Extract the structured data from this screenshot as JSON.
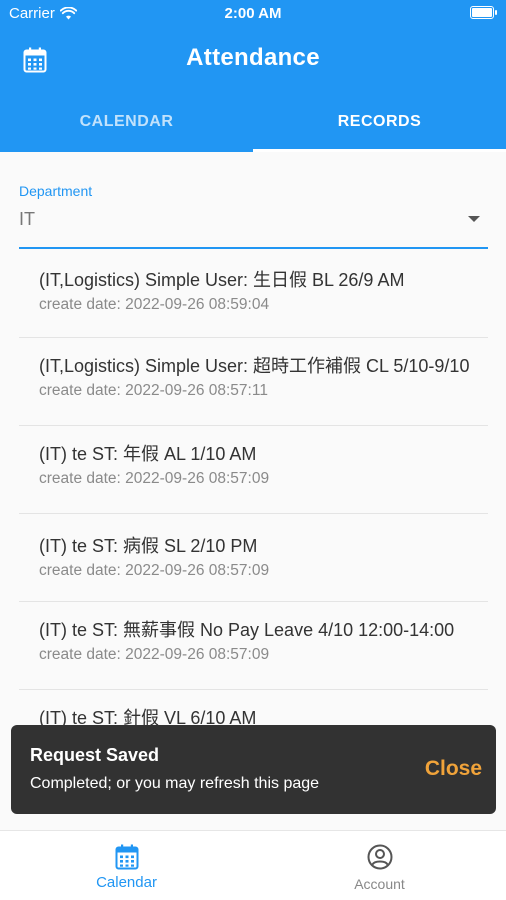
{
  "status_bar": {
    "carrier": "Carrier",
    "time": "2:00 AM"
  },
  "app_bar": {
    "title": "Attendance",
    "leading_icon": "calendar-icon"
  },
  "tabs": [
    {
      "label": "CALENDAR",
      "active": false
    },
    {
      "label": "RECORDS",
      "active": true
    }
  ],
  "department": {
    "label": "Department",
    "value": "IT"
  },
  "records": [
    {
      "title": "(IT,Logistics) Simple User: 生日假 BL 26/9 AM",
      "date": "create date: 2022-09-26 08:59:04"
    },
    {
      "title": "(IT,Logistics) Simple User: 超時工作補假 CL 5/10-9/10",
      "date": "create date: 2022-09-26 08:57:11"
    },
    {
      "title": "(IT) te ST: 年假 AL 1/10 AM",
      "date": "create date: 2022-09-26 08:57:09"
    },
    {
      "title": "(IT) te ST: 病假 SL 2/10 PM",
      "date": "create date: 2022-09-26 08:57:09"
    },
    {
      "title": "(IT) te ST: 無薪事假 No Pay Leave 4/10 12:00-14:00",
      "date": "create date: 2022-09-26 08:57:09"
    },
    {
      "title": "(IT) te ST: 針假 VL 6/10 AM",
      "date": ""
    }
  ],
  "snackbar": {
    "title": "Request Saved",
    "message": "Completed; or you may refresh this page",
    "action": "Close"
  },
  "bottom_nav": [
    {
      "label": "Calendar",
      "icon": "calendar-icon",
      "active": true
    },
    {
      "label": "Account",
      "icon": "account-icon",
      "active": false
    }
  ],
  "colors": {
    "primary": "#2196f3",
    "snackbar_bg": "#323232",
    "snackbar_action": "#f0a33a"
  }
}
